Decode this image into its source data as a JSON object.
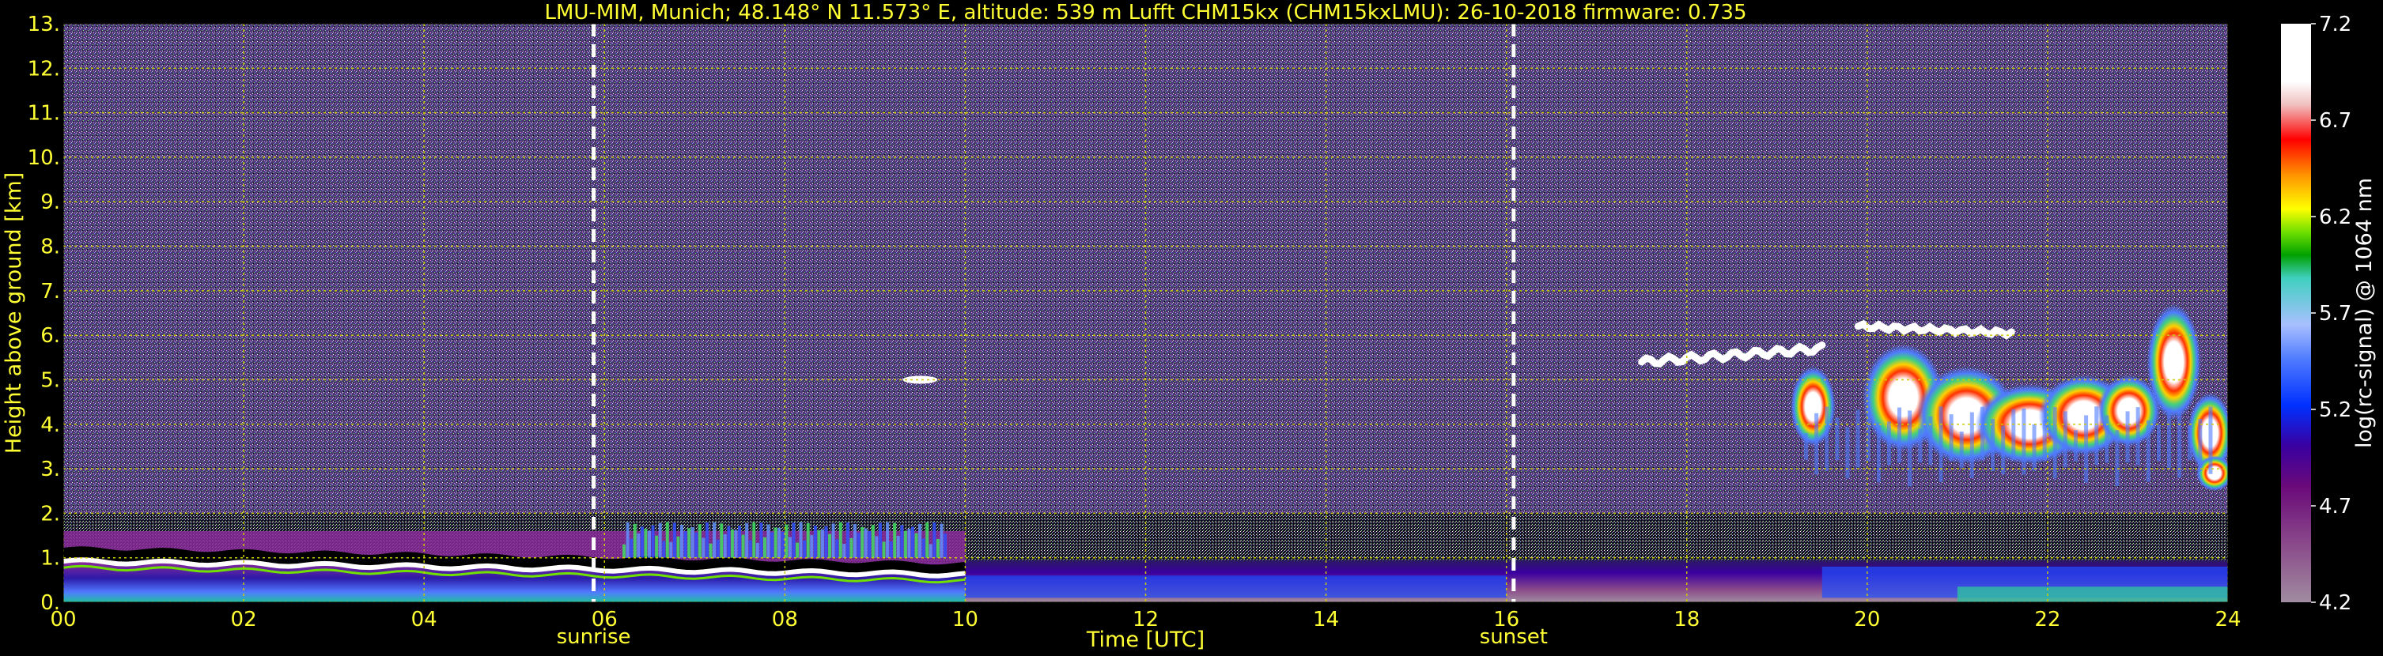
{
  "chart_data": {
    "type": "heatmap",
    "title": "LMU-MIM, Munich; 48.148° N 11.573° E, altitude: 539 m     Lufft CHM15kx (CHM15kxLMU): 26-10-2018    firmware: 0.735",
    "xlabel": "Time [UTC]",
    "ylabel": "Height above ground [km]",
    "xlim": [
      0,
      24
    ],
    "ylim": [
      0,
      13
    ],
    "grid": true,
    "x_ticks": [
      "00",
      "02",
      "04",
      "06",
      "08",
      "10",
      "12",
      "14",
      "16",
      "18",
      "20",
      "22",
      "24"
    ],
    "y_ticks": [
      "0.",
      "1.",
      "2.",
      "3.",
      "4.",
      "5.",
      "6.",
      "7.",
      "8.",
      "9.",
      "10.",
      "11.",
      "12.",
      "13."
    ],
    "colorbar": {
      "label": "log(rc-signal) @ 1064 nm",
      "range": [
        4.2,
        7.2
      ],
      "ticks": [
        "4.2",
        "4.7",
        "5.2",
        "5.7",
        "6.2",
        "6.7",
        "7.2"
      ]
    },
    "markers": [
      {
        "label": "sunrise",
        "x": 5.88
      },
      {
        "label": "sunset",
        "x": 16.08
      }
    ],
    "features": [
      {
        "name": "boundary layer",
        "x_range": [
          0,
          24
        ],
        "y_range": [
          0,
          1.2
        ]
      },
      {
        "name": "aerosol layer top",
        "x_range": [
          0,
          10
        ],
        "y": 0.8
      },
      {
        "name": "cloud",
        "x_range": [
          9.2,
          9.8
        ],
        "y": 5.0
      },
      {
        "name": "cloud",
        "x_range": [
          17.5,
          19.5
        ],
        "y": 5.5
      },
      {
        "name": "cloud",
        "x_range": [
          19.0,
          23.4
        ],
        "y_range": [
          3.0,
          6.4
        ]
      },
      {
        "name": "cloud",
        "x_range": [
          22.7,
          24.0
        ],
        "y_range": [
          2.5,
          6.8
        ]
      }
    ]
  },
  "colors": {
    "annotation": "#ffff33",
    "background_noise": "#4b3a73",
    "grid": "#cccc00",
    "colorbar_stops": [
      "#a08ca0",
      "#8a4a8a",
      "#6a0a7a",
      "#3a00a0",
      "#0030ff",
      "#4f7bff",
      "#a8c0ff",
      "#40d0c0",
      "#00a000",
      "#70e000",
      "#ffff00",
      "#ff9000",
      "#ff0000",
      "#f0c0c0",
      "#ffffff"
    ]
  }
}
